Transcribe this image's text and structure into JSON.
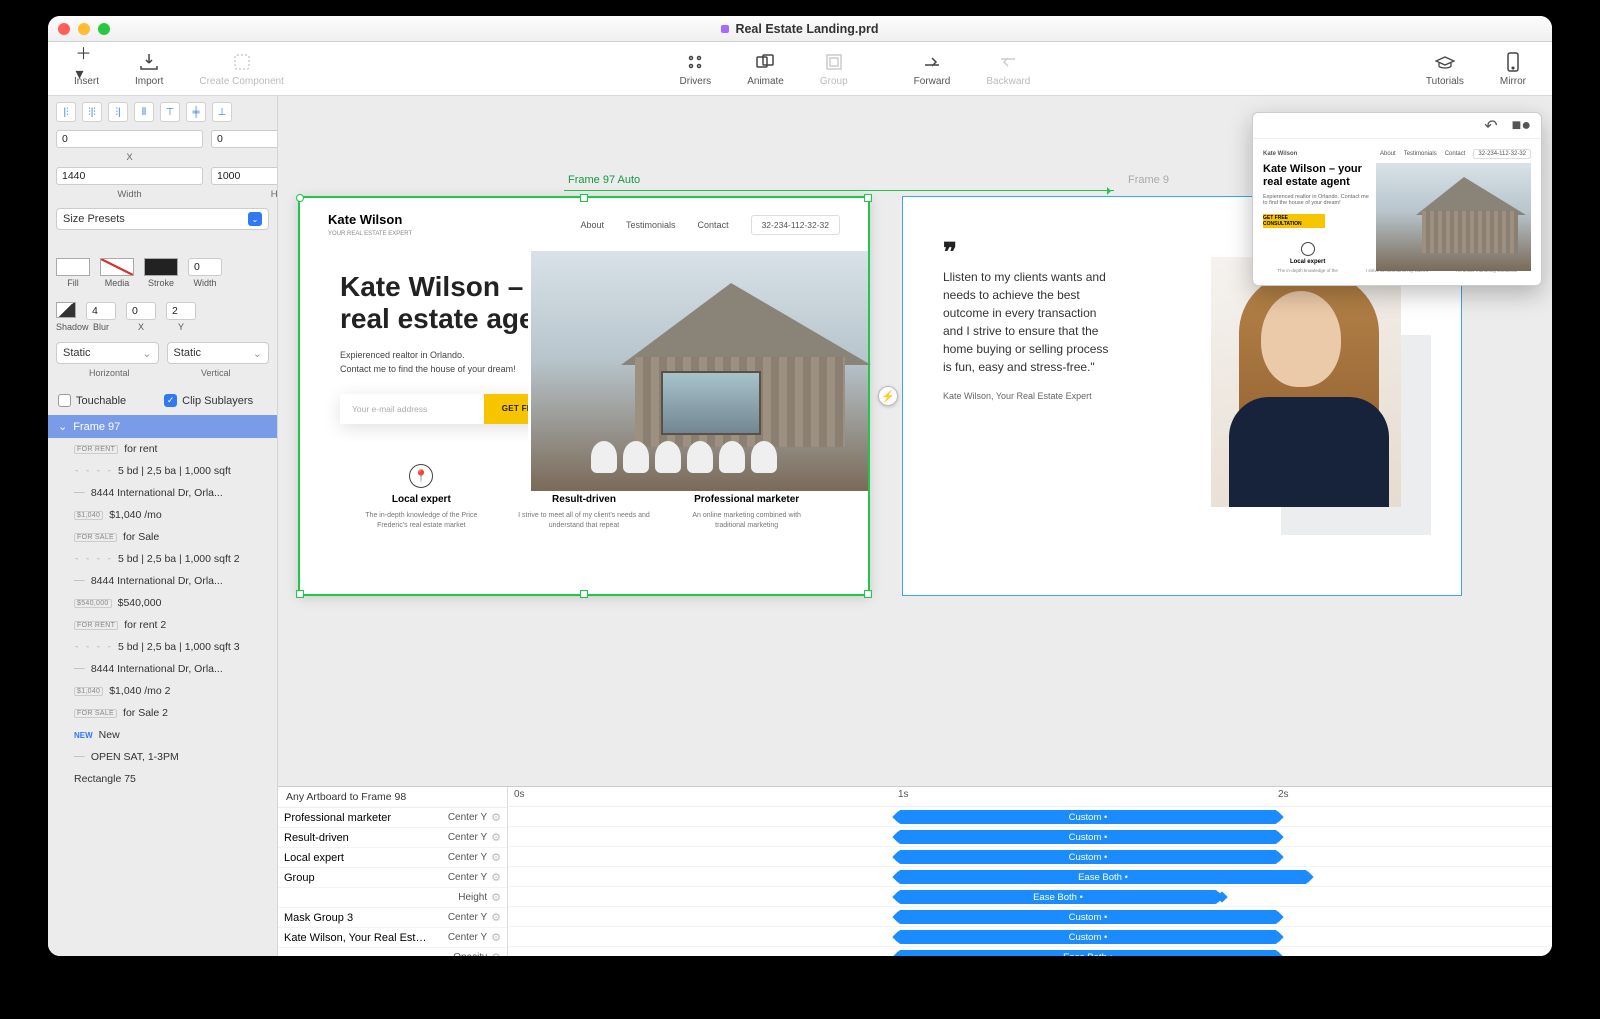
{
  "window_title": "Real Estate Landing.prd",
  "toolbar": {
    "insert": "Insert",
    "import": "Import",
    "create_component": "Create Component",
    "drivers": "Drivers",
    "animate": "Animate",
    "group": "Group",
    "forward": "Forward",
    "backward": "Backward",
    "tutorials": "Tutorials",
    "mirror": "Mirror"
  },
  "inspector": {
    "x": "0",
    "y": "0",
    "x_lbl": "X",
    "y_lbl": "Y",
    "w": "1440",
    "h": "1000",
    "w_lbl": "Width",
    "h_lbl": "Height",
    "size_presets": "Size Presets",
    "fill_lbl": "Fill",
    "media_lbl": "Media",
    "stroke_lbl": "Stroke",
    "stroke_w_lbl": "Width",
    "stroke_w": "0",
    "shadow_lbl": "Shadow",
    "blur_lbl": "Blur",
    "sx_lbl": "X",
    "sy_lbl": "Y",
    "shadow_opacity": "4",
    "sx": "0",
    "sy": "2",
    "horiz_sel": "Static",
    "vert_sel": "Static",
    "horiz_lbl": "Horizontal",
    "vert_lbl": "Vertical",
    "touchable": "Touchable",
    "clip": "Clip Sublayers"
  },
  "layers": {
    "selected": "Frame 97",
    "items": [
      {
        "badge": "FOR RENT",
        "text": "for rent"
      },
      {
        "dashes": "- - - -",
        "text": "5 bd | 2,5 ba | 1,000 sqft"
      },
      {
        "dashes": "——",
        "text": "8444 International Dr, Orla..."
      },
      {
        "badge": "$1,040",
        "text": "$1,040 /mo"
      },
      {
        "badge": "FOR SALE",
        "text": "for Sale"
      },
      {
        "dashes": "- - - -",
        "text": "5 bd | 2,5 ba | 1,000 sqft 2"
      },
      {
        "dashes": "——",
        "text": "8444 International Dr, Orla..."
      },
      {
        "badge": "$540,000",
        "text": "$540,000"
      },
      {
        "badge": "FOR RENT",
        "text": "for rent 2"
      },
      {
        "dashes": "- - - -",
        "text": "5 bd | 2,5 ba | 1,000 sqft 3"
      },
      {
        "dashes": "——",
        "text": "8444 International Dr, Orla..."
      },
      {
        "badge": "$1,040",
        "text": "$1,040 /mo 2"
      },
      {
        "badge": "FOR SALE",
        "text": "for Sale 2"
      },
      {
        "new": "NEW",
        "text": "New"
      },
      {
        "dashes": "——",
        "text": "OPEN SAT, 1-3PM"
      },
      {
        "text": "Rectangle 75"
      }
    ]
  },
  "canvas": {
    "frame1_label": "Frame 97 Auto",
    "frame2_label": "Frame 9",
    "mockup1": {
      "brand": "Kate Wilson",
      "brand_sub": "YOUR REAL ESTATE EXPERT",
      "nav": {
        "about": "About",
        "test": "Testimonials",
        "contact": "Contact",
        "phone": "32-234-112-32-32"
      },
      "h1": "Kate Wilson – your real estate agent",
      "sub1": "Expierenced realtor in Orlando.",
      "sub2": "Contact me to find the house of your dream!",
      "email_ph": "Your e-mail address",
      "cta": "GET FREE CONSULTATION",
      "feat": [
        {
          "t": "Local expert",
          "d": "The in-depth knowledge of the Price Frederic's real estate market"
        },
        {
          "t": "Result-driven",
          "d": "I strive to meet all of my client's needs and understand that repeat"
        },
        {
          "t": "Professional marketer",
          "d": "An online marketing combined with traditional marketing"
        }
      ]
    },
    "mockup2": {
      "quote": "Llisten to my clients wants and needs to achieve the best outcome in every transaction and I strive to ensure that the home buying or selling process is fun, easy and stress-free.\"",
      "author": "Kate Wilson, Your Real Estate Expert"
    }
  },
  "preview": {
    "brand": "Kate Wilson",
    "links": [
      "About",
      "Testimonials",
      "Contact"
    ],
    "phone": "32-234-112-32-32",
    "h1": "Kate Wilson – your real estate agent",
    "sub": "Expierenced realtor in Orlando. Contact me to find the house of your dream!",
    "cta": "GET FREE CONSULTATION",
    "feat": [
      {
        "t": "Local expert",
        "d": "The in-depth knowledge of the"
      },
      {
        "t": "Result-driven",
        "d": "I strive to meet all of my client's"
      },
      {
        "t": "Professional marketer",
        "d": "An online marketing combined"
      }
    ]
  },
  "timeline": {
    "header": "Any Artboard to Frame 98",
    "ticks": [
      "0s",
      "1s",
      "2s"
    ],
    "rows": [
      {
        "name": "Professional marketer",
        "prop": "Center Y",
        "bar": "Custom •",
        "start": 390,
        "len": 380
      },
      {
        "name": "Result-driven",
        "prop": "Center Y",
        "bar": "Custom •",
        "start": 390,
        "len": 380
      },
      {
        "name": "Local expert",
        "prop": "Center Y",
        "bar": "Custom •",
        "start": 390,
        "len": 380
      },
      {
        "name": "Group",
        "prop": "Center Y",
        "bar": "Ease Both •",
        "start": 390,
        "len": 410
      },
      {
        "name": "",
        "prop": "Height",
        "bar": "Ease Both •",
        "start": 390,
        "len": 320,
        "extra_diamond": 710
      },
      {
        "name": "Mask Group 3",
        "prop": "Center Y",
        "bar": "Custom •",
        "start": 390,
        "len": 380
      },
      {
        "name": "Kate Wilson, Your Real Estate Expert",
        "prop": "Center Y",
        "bar": "Custom •",
        "start": 390,
        "len": 380
      },
      {
        "name": "",
        "prop": "Opacity",
        "bar": "Ease Both •",
        "start": 390,
        "len": 380
      }
    ]
  }
}
